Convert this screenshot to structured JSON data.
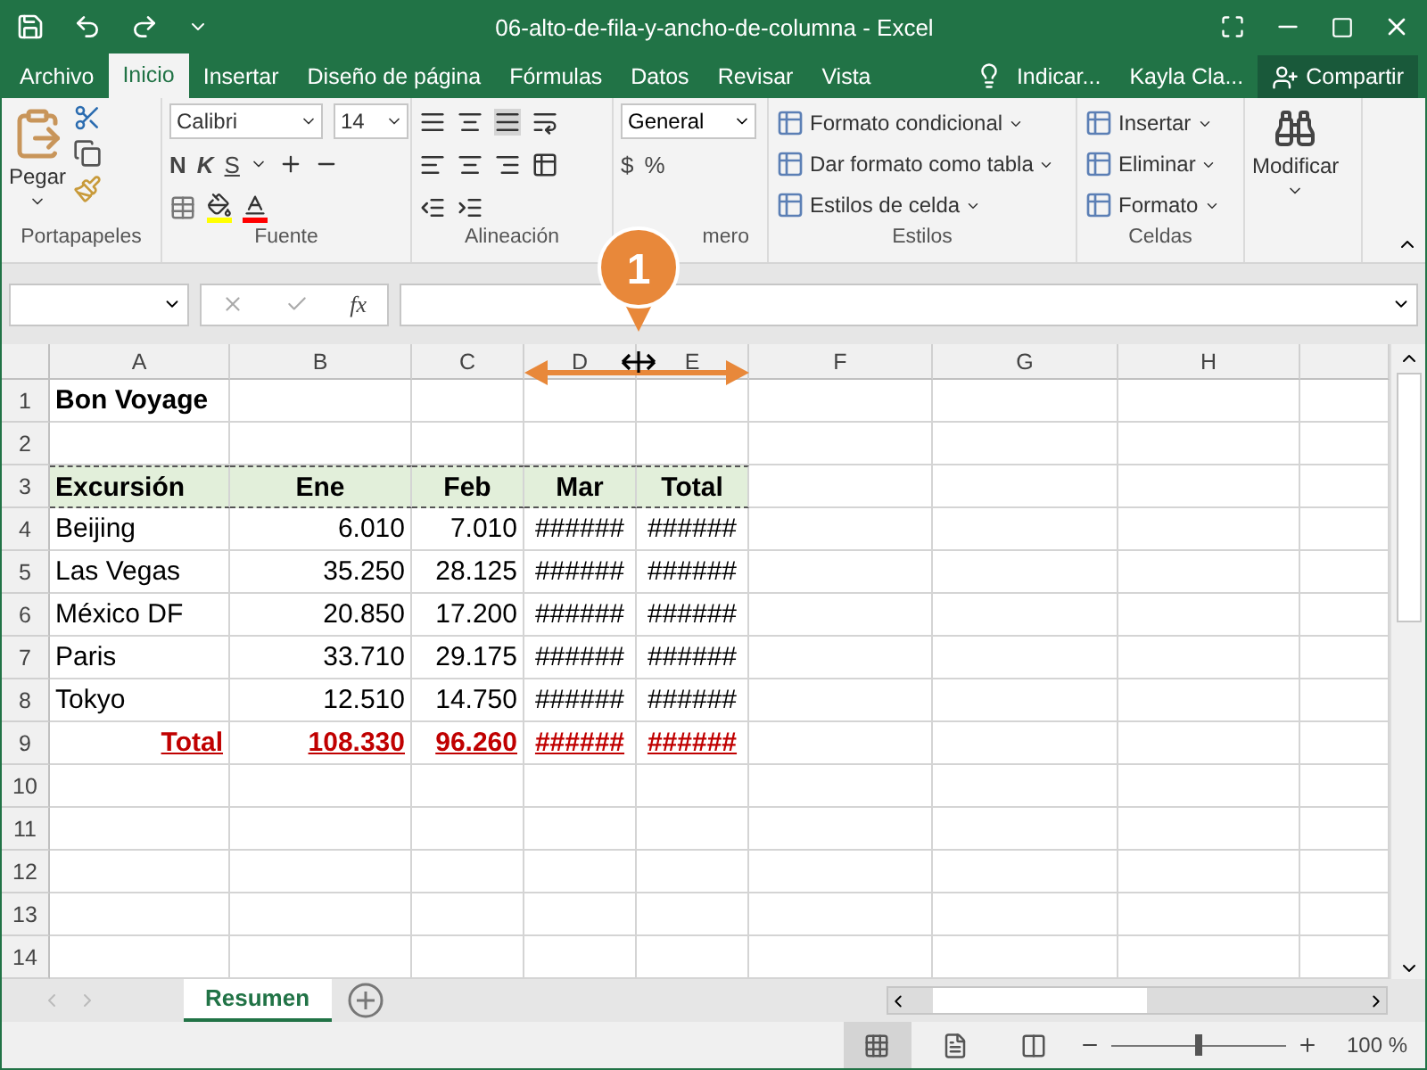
{
  "window": {
    "title": "06-alto-de-fila-y-ancho-de-columna  -  Excel"
  },
  "menu_tabs": [
    {
      "label": "Archivo",
      "selected": false
    },
    {
      "label": "Inicio",
      "selected": true
    },
    {
      "label": "Insertar",
      "selected": false
    },
    {
      "label": "Diseño de página",
      "selected": false
    },
    {
      "label": "Fórmulas",
      "selected": false
    },
    {
      "label": "Datos",
      "selected": false
    },
    {
      "label": "Revisar",
      "selected": false
    },
    {
      "label": "Vista",
      "selected": false
    }
  ],
  "tell_me": "Indicar...",
  "user": "Kayla Cla...",
  "share": "Compartir",
  "ribbon": {
    "clipboard": {
      "label": "Portapapeles",
      "paste": "Pegar"
    },
    "font": {
      "label": "Fuente",
      "font_name": "Calibri",
      "font_size": "14",
      "bold": "N",
      "italic": "K",
      "underline": "S"
    },
    "alignment": {
      "label": "Alineación"
    },
    "number": {
      "label": "mero",
      "format": "General",
      "currency": "$",
      "percent": "%"
    },
    "styles": {
      "label": "Estilos",
      "items": [
        "Formato condicional",
        "Dar formato como tabla",
        "Estilos de celda"
      ]
    },
    "cells": {
      "label": "Celdas",
      "items": [
        "Insertar",
        "Eliminar",
        "Formato"
      ]
    },
    "editing": {
      "label": "Modificar"
    }
  },
  "formula_bar": {
    "fx": "fx"
  },
  "columns": [
    "A",
    "B",
    "C",
    "D",
    "E",
    "F",
    "G",
    "H"
  ],
  "rows": [
    {
      "number": "1",
      "kind": "title",
      "cells": [
        "Bon Voyage",
        "",
        "",
        "",
        ""
      ]
    },
    {
      "number": "2",
      "kind": "empty",
      "cells": []
    },
    {
      "number": "3",
      "kind": "header",
      "cells": [
        "Excursión",
        "Ene",
        "Feb",
        "Mar",
        "Total"
      ]
    },
    {
      "number": "4",
      "kind": "data",
      "cells": [
        "Beijing",
        "6.010",
        "7.010",
        "######",
        "######"
      ]
    },
    {
      "number": "5",
      "kind": "data",
      "cells": [
        "Las Vegas",
        "35.250",
        "28.125",
        "######",
        "######"
      ]
    },
    {
      "number": "6",
      "kind": "data",
      "cells": [
        "México DF",
        "20.850",
        "17.200",
        "######",
        "######"
      ]
    },
    {
      "number": "7",
      "kind": "data",
      "cells": [
        "Paris",
        "33.710",
        "29.175",
        "######",
        "######"
      ]
    },
    {
      "number": "8",
      "kind": "data",
      "cells": [
        "Tokyo",
        "12.510",
        "14.750",
        "######",
        "######"
      ]
    },
    {
      "number": "9",
      "kind": "total",
      "cells": [
        "Total",
        "108.330",
        "96.260",
        "######",
        "######"
      ]
    },
    {
      "number": "10",
      "kind": "empty",
      "cells": []
    },
    {
      "number": "11",
      "kind": "empty",
      "cells": []
    },
    {
      "number": "12",
      "kind": "empty",
      "cells": []
    },
    {
      "number": "13",
      "kind": "empty",
      "cells": []
    },
    {
      "number": "14",
      "kind": "empty",
      "cells": []
    }
  ],
  "callout": {
    "number": "1"
  },
  "sheet_tabs": [
    {
      "label": "Resumen",
      "selected": true
    }
  ],
  "views": [
    {
      "kind": "normal",
      "selected": true
    },
    {
      "kind": "page_layout",
      "selected": false
    },
    {
      "kind": "page_break",
      "selected": false
    }
  ],
  "zoom": {
    "level": 0.5,
    "reading": "100 %"
  }
}
